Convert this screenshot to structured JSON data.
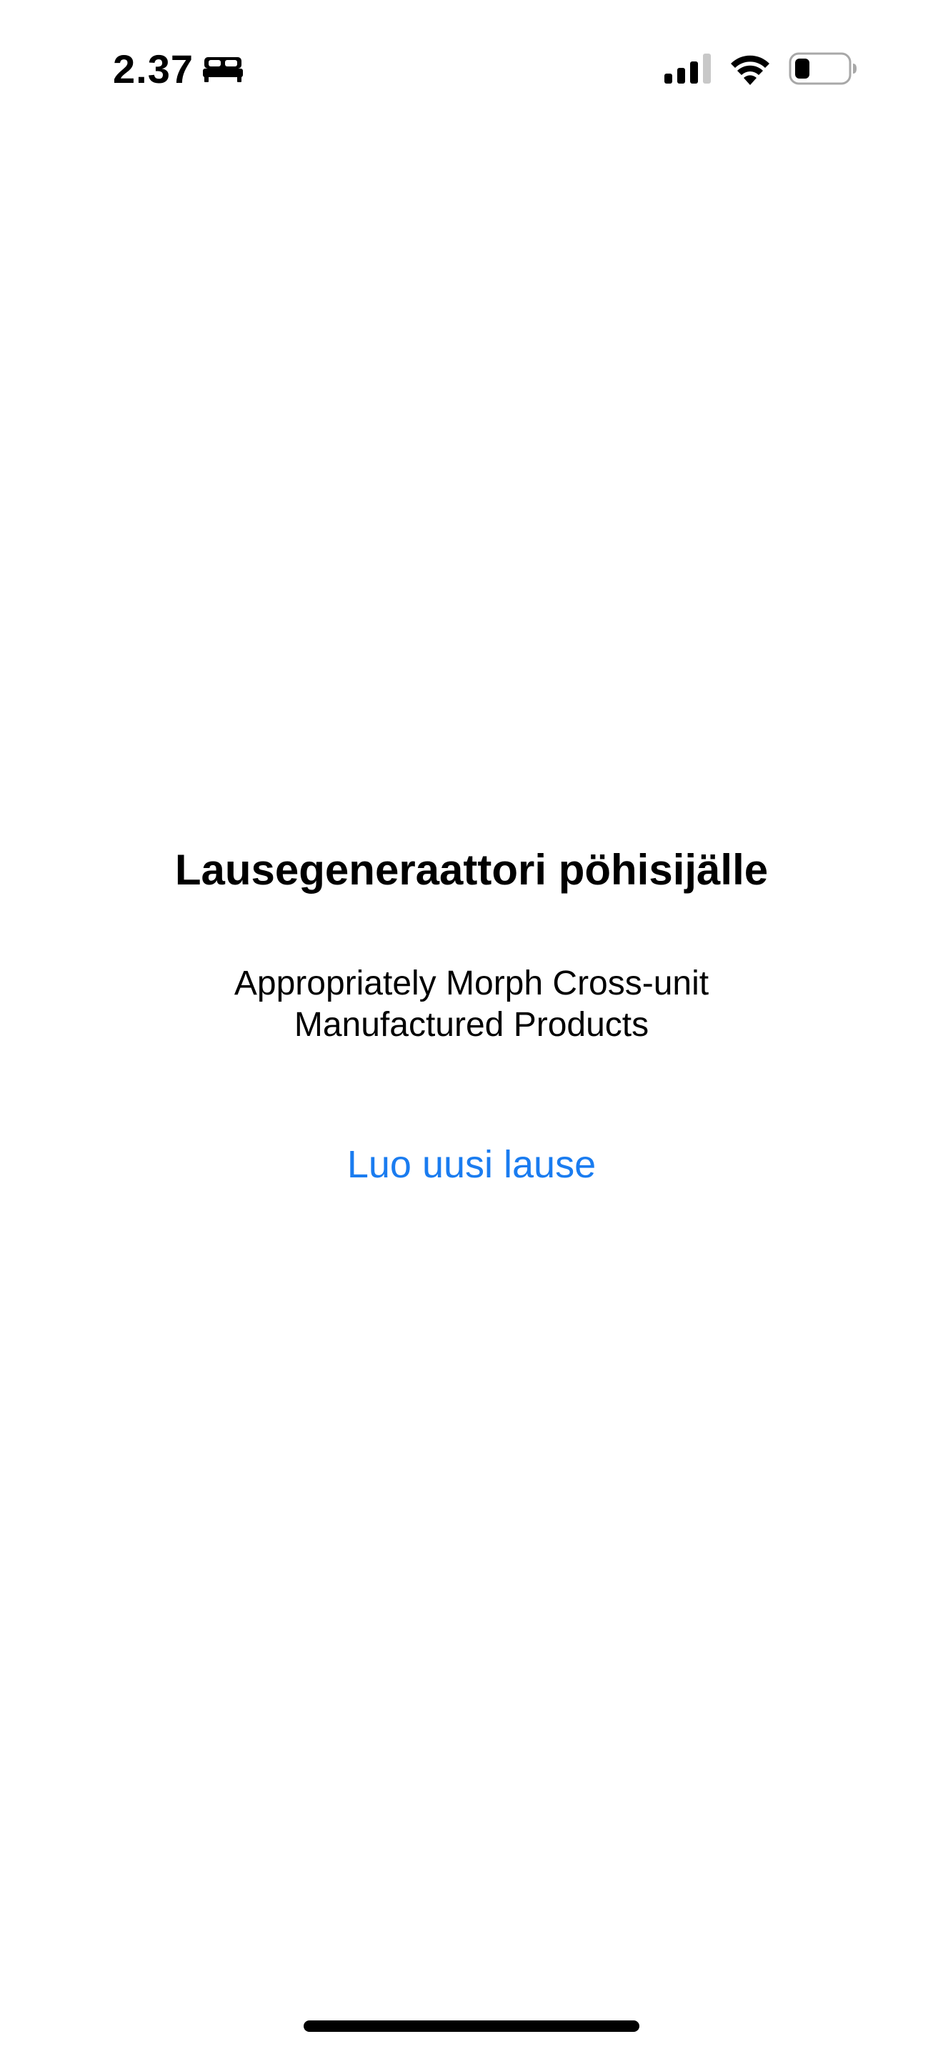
{
  "status_bar": {
    "time": "2.37",
    "focus_icon": "bed-icon",
    "signal_icon": "cellular-signal-icon",
    "wifi_icon": "wifi-icon",
    "battery_icon": "battery-icon",
    "signal_bars_active": 3,
    "signal_bars_total": 4,
    "battery_level": 0.2
  },
  "main": {
    "title": "Lausegeneraattori pöhisijälle",
    "sentence_line1": "Appropriately Morph Cross-unit",
    "sentence_line2": "Manufactured Products",
    "generate_button_label": "Luo uusi lause"
  },
  "colors": {
    "background": "#ffffff",
    "text": "#000000",
    "accent": "#1a7cf0"
  }
}
